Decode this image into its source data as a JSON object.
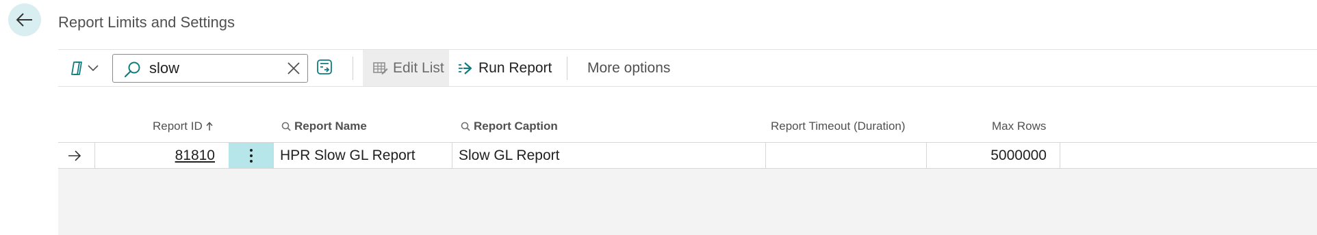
{
  "page": {
    "title": "Report Limits and Settings"
  },
  "toolbar": {
    "search_value": "slow",
    "edit_list_label": "Edit List",
    "run_report_label": "Run Report",
    "more_options_label": "More options"
  },
  "table": {
    "columns": {
      "report_id": "Report ID",
      "report_name": "Report Name",
      "report_caption": "Report Caption",
      "report_timeout": "Report Timeout (Duration)",
      "max_rows": "Max Rows"
    },
    "sort": {
      "column": "report_id",
      "direction": "ascending"
    },
    "rows": [
      {
        "report_id": "81810",
        "report_name": "HPR Slow GL Report",
        "report_caption": "Slow GL Report",
        "report_timeout": "",
        "max_rows": "5000000"
      }
    ]
  },
  "icons": {
    "back": "arrow-left-icon",
    "copilot": "copilot-icon",
    "search": "search-icon",
    "clear": "close-icon",
    "filter": "filter-pane-icon",
    "edit_list": "edit-list-icon",
    "run_report": "run-report-icon",
    "row_indicator": "arrow-right-icon",
    "row_actions": "more-vertical-icon",
    "column_search": "search-icon",
    "sort": "arrow-up-icon"
  },
  "colors": {
    "accent": "#0f7b7f",
    "back_button_bg": "#d9eef0",
    "row_actions_bg": "#b6e6ea",
    "selected_action_bg": "#ededed"
  }
}
